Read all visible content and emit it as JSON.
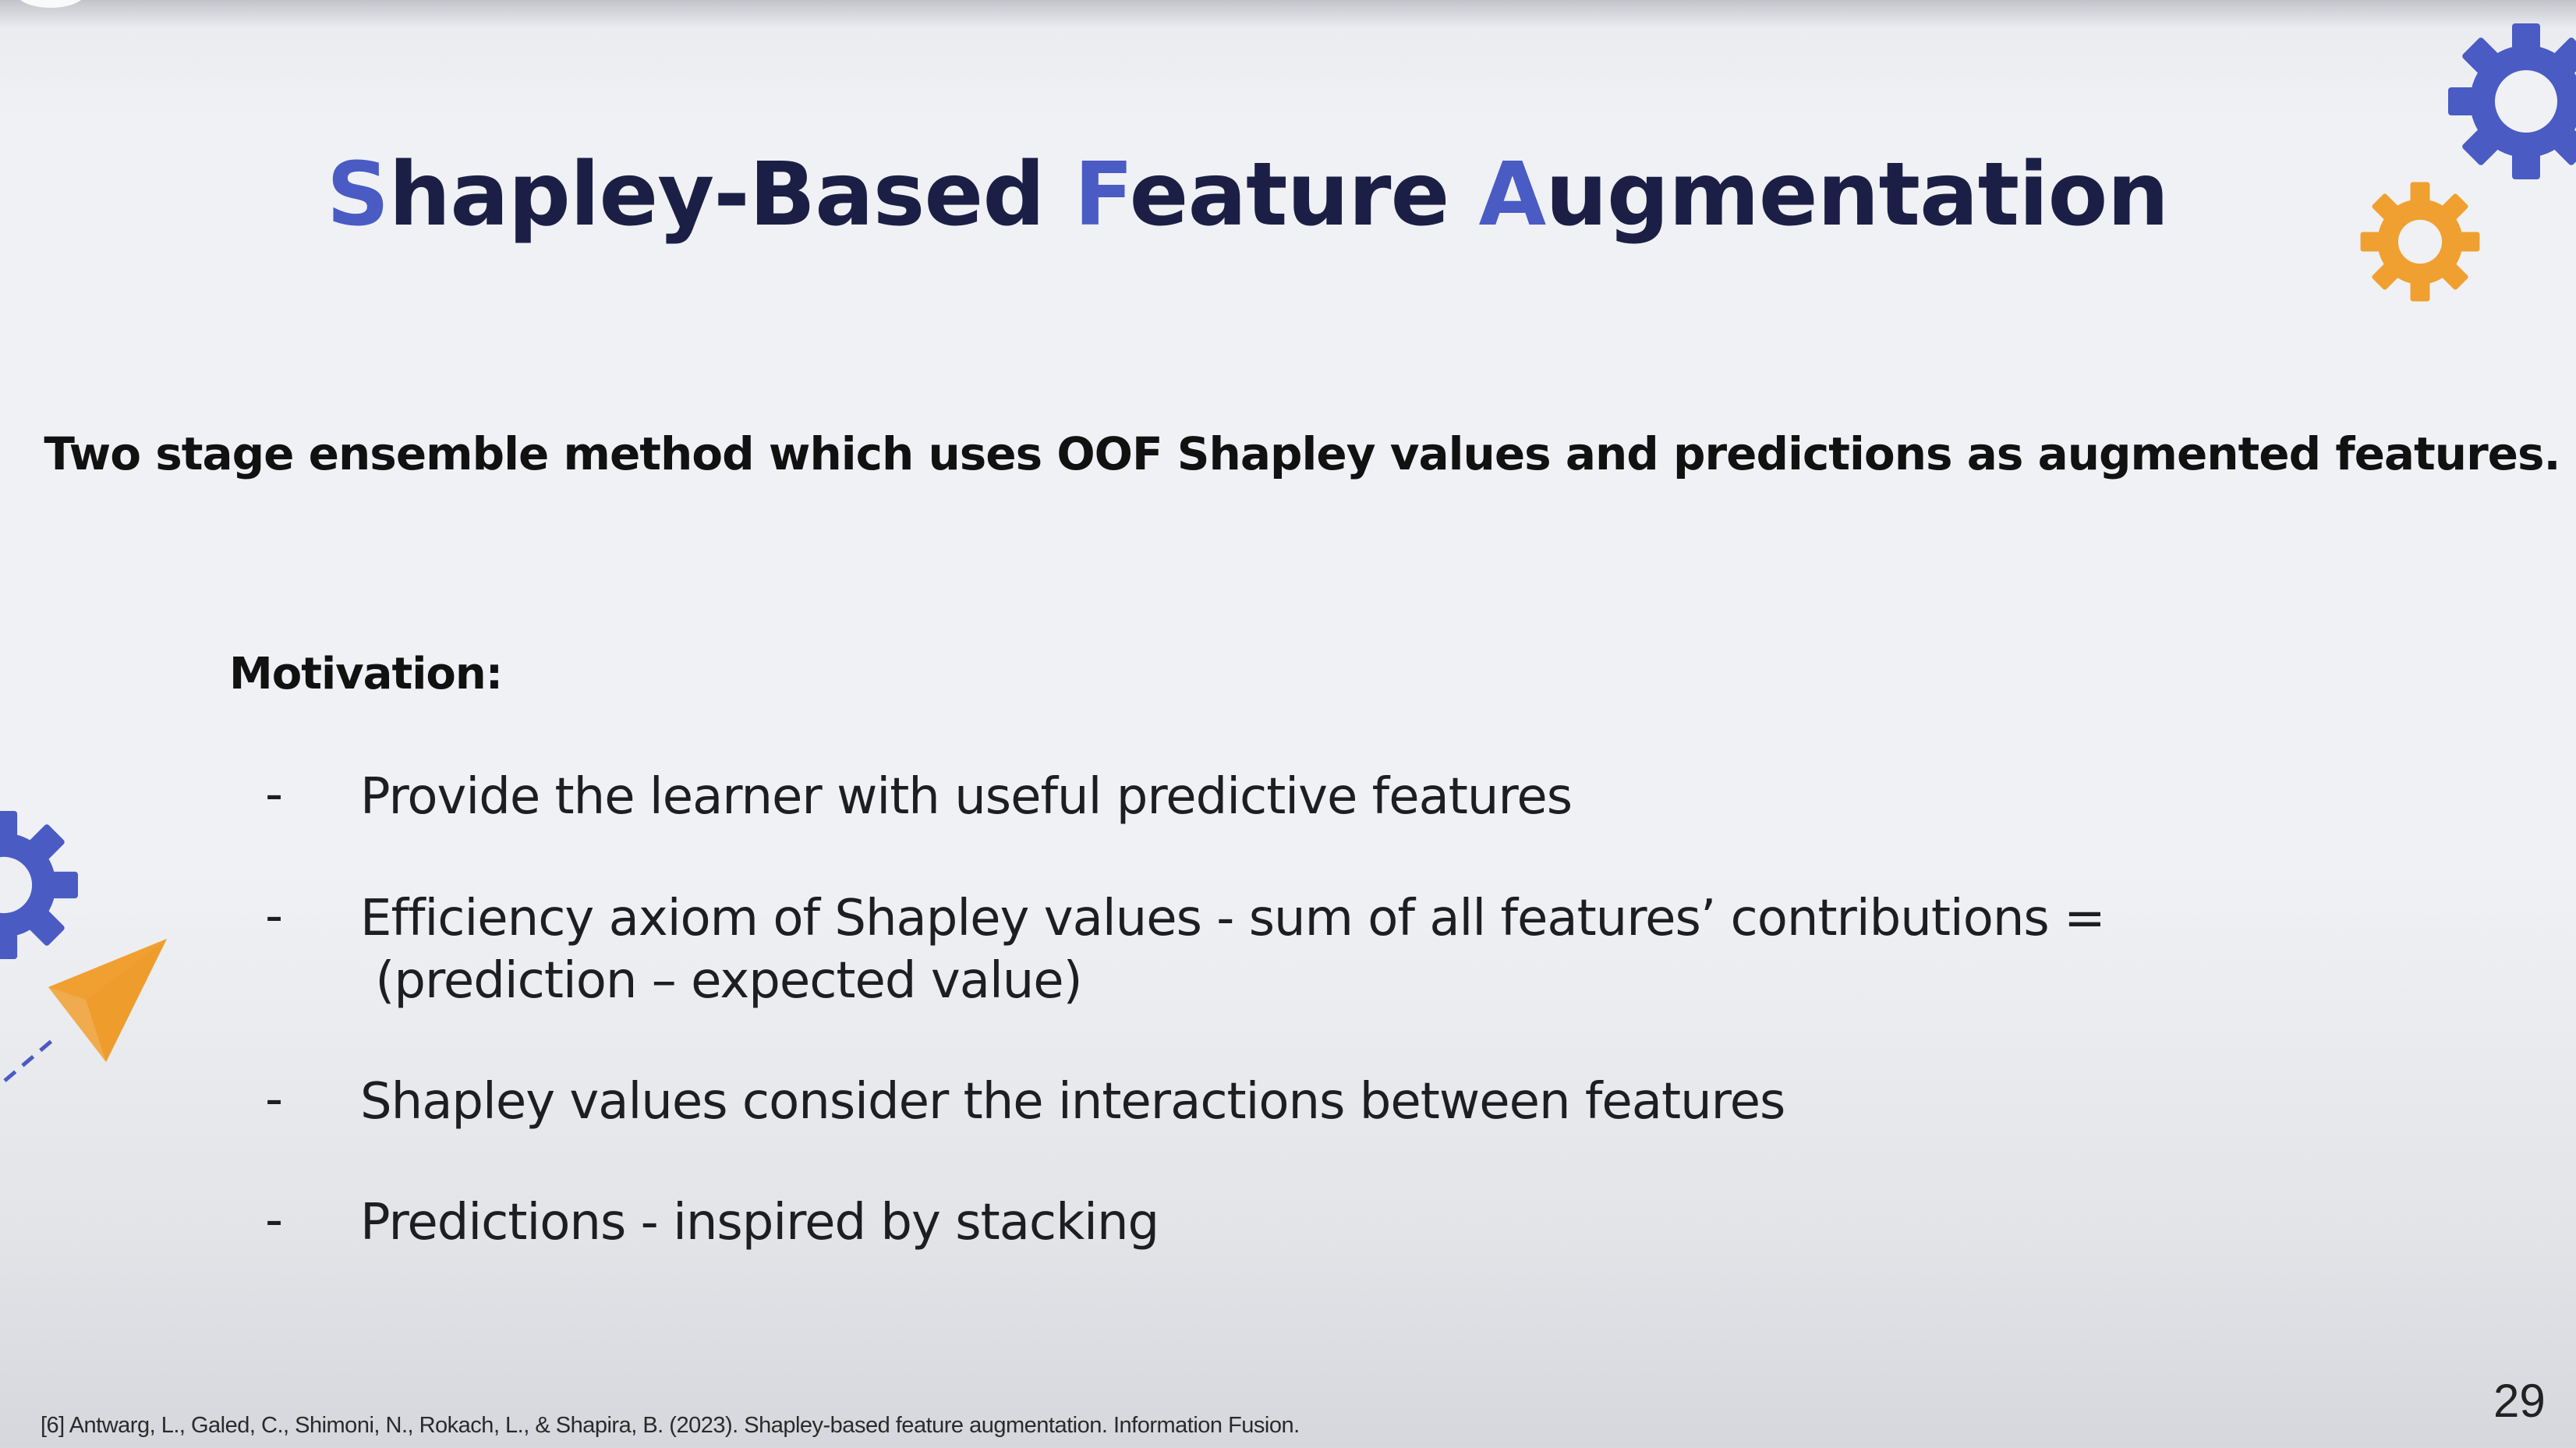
{
  "slide": {
    "title_parts": [
      {
        "text": "S",
        "accent": true
      },
      {
        "text": "hapley-Based ",
        "accent": false
      },
      {
        "text": "F",
        "accent": true
      },
      {
        "text": "eature ",
        "accent": false
      },
      {
        "text": "A",
        "accent": true
      },
      {
        "text": "ugmentation",
        "accent": false
      }
    ],
    "subtitle": "Two stage ensemble method which uses OOF Shapley values and predictions as augmented features.",
    "motivation_heading": "Motivation:",
    "bullets": [
      {
        "dash": "-",
        "line1": "Provide the learner with useful predictive features",
        "line2": ""
      },
      {
        "dash": "-",
        "line1": "Efficiency axiom of Shapley values -  sum of all features’ contributions =",
        "line2": " (prediction – expected value)"
      },
      {
        "dash": "-",
        "line1": "Shapley values consider the interactions between features",
        "line2": ""
      },
      {
        "dash": "-",
        "line1": "Predictions - inspired by stacking",
        "line2": ""
      }
    ],
    "footnote": "[6] Antwarg, L., Galed, C., Shimoni, N., Rokach, L., & Shapira, B. (2023). Shapley-based feature augmentation. Information Fusion.",
    "page_number": "29"
  },
  "colors": {
    "title": "#1c1f45",
    "accent": "#4a5bc4",
    "gear_blue": "#4a5bc4",
    "gear_orange": "#f0a030",
    "plane_orange": "#f0a030"
  },
  "icons": [
    "gear-icon",
    "gear-icon",
    "gear-icon",
    "paper-plane-icon"
  ]
}
